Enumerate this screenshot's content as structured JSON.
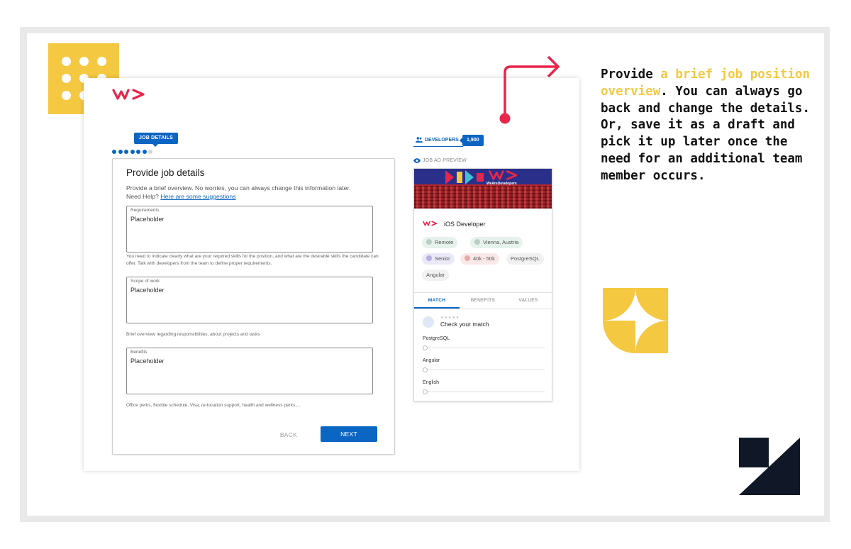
{
  "colors": {
    "accent": "#0b65c2",
    "brand_red": "#e8254a",
    "deco_yellow": "#f5c842",
    "deco_dark": "#101828"
  },
  "brand": {
    "logo_icon": "wearedevelopers-logo-icon"
  },
  "stepper": {
    "badge": "JOB DETAILS",
    "total_steps": 7,
    "current_step": 6
  },
  "form": {
    "title": "Provide job details",
    "intro": "Provide a brief overview. No worries, you can always change this information later.",
    "help_prefix": "Need Help?",
    "help_link": "Here are some suggestions",
    "fields": [
      {
        "label": "Requirements",
        "value": "Placeholder",
        "hint": "You need to indicate clearly what are your required skills for the position, and what are the desirable skills the candidate can offer. Talk with developers from the team to define proper requirements."
      },
      {
        "label": "Scope of work",
        "value": "Placeholder",
        "hint": "Brief overview regarding responsibilities, about projects and tasks"
      },
      {
        "label": "Benefits",
        "value": "Placeholder",
        "hint": "Office perks, flexible schedule, Visa, re-location support, health and wellness perks,..."
      }
    ],
    "back_label": "BACK",
    "next_label": "NEXT"
  },
  "developers": {
    "label": "DEVELOPERS",
    "count": "1,900",
    "icon": "people-icon"
  },
  "preview": {
    "label": "JOB AD PREVIEW",
    "icon": "eye-icon",
    "banner_text": "WeAreDevelopers",
    "job_title": "iOS Developer",
    "chips": [
      {
        "text": "Remote",
        "icon": "location-pin-icon",
        "bg": "#e6f2ec"
      },
      {
        "text": "Vienna, Austria",
        "icon": "location-pin-icon",
        "bg": "#e6f2ec"
      },
      {
        "text": "Senior",
        "icon": "level-icon",
        "bg": "#ebe8f7"
      },
      {
        "text": "40k - 50k",
        "icon": "euro-icon",
        "bg": "#fae8e8"
      },
      {
        "text": "PostgreSQL",
        "icon": "",
        "bg": "#f1f1f1"
      },
      {
        "text": "Angular",
        "icon": "",
        "bg": "#f1f1f1"
      }
    ],
    "tabs": [
      "MATCH",
      "BENEFITS",
      "VALUES"
    ],
    "active_tab": "MATCH",
    "match_title": "Check your match",
    "skills": [
      "PostgreSQL",
      "Angular",
      "English"
    ]
  },
  "callout": {
    "before": "Provide ",
    "highlight": "a brief job position overview",
    "after": ". You can always go back and change the details. Or, save it as a draft and pick it up later once the need for an additional team member occurs."
  }
}
